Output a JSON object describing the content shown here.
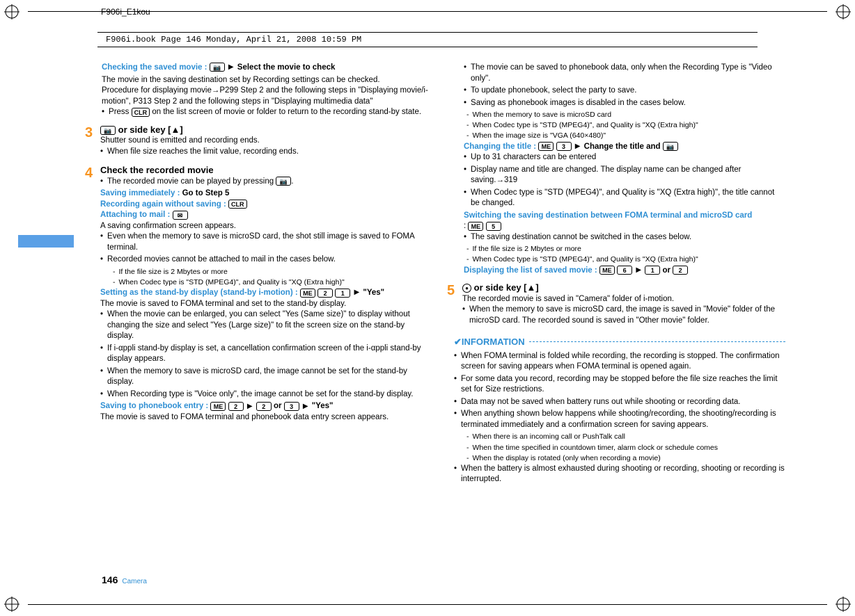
{
  "doc_header": "F906i_E1kou",
  "book_meta": "F906i.book  Page 146  Monday, April 21, 2008  10:59 PM",
  "page_number": "146",
  "page_category": "Camera",
  "left": {
    "check_saved": {
      "label": "Checking the saved movie : ",
      "after": "Select the movie to check",
      "desc1": "The movie in the saving destination set by Recording settings can be checked.",
      "desc2": "Procedure for displaying movie→P299 Step 2 and the following steps in \"Displaying movie/i-motion\", P313 Step 2 and the following steps in \"Displaying multimedia data\"",
      "bullet1_a": "Press ",
      "bullet1_b": " on the list screen of movie or folder to return to the recording stand-by state."
    },
    "step3": {
      "num": "3",
      "head_a": " or side key [",
      "head_b": "]",
      "l1": "Shutter sound is emitted and recording ends.",
      "b1": "When file size reaches the limit value, recording ends."
    },
    "step4": {
      "num": "4",
      "head": "Check the recorded movie",
      "b1_a": "The recorded movie can be played by pressing ",
      "b1_b": ".",
      "save_imm_lbl": "Saving immediately : ",
      "save_imm_val": "Go to Step 5",
      "rec_again_lbl": "Recording again without saving : ",
      "attach_lbl": "Attaching to mail : ",
      "attach_l1": "A saving confirmation screen appears.",
      "attach_b1": "Even when the memory to save is microSD card, the shot still image is saved to FOMA terminal.",
      "attach_b2": "Recorded movies cannot be attached to mail in the cases below.",
      "attach_d1": "If the file size is 2 Mbytes or more",
      "attach_d2": "When Codec type is \"STD (MPEG4)\", and Quality is \"XQ (Extra high)\"",
      "standby_lbl": "Setting as the stand-by display (stand-by i-motion) : ",
      "standby_after": "\"Yes\"",
      "standby_l1": "The movie is saved to FOMA terminal and set to the stand-by display.",
      "standby_b1": "When the movie can be enlarged, you can select \"Yes (Same size)\" to display without changing the size and select \"Yes (Large size)\" to fit the screen size on the stand-by display.",
      "standby_b2": "If i-αppli stand-by display is set, a cancellation confirmation screen of the i-αppli stand-by display appears.",
      "standby_b3": "When the memory to save is microSD card, the image cannot be set for the stand-by display.",
      "standby_b4": "When Recording type is \"Voice only\", the image cannot be set for the stand-by display.",
      "pb_lbl": "Saving to phonebook entry : ",
      "pb_mid": " or ",
      "pb_after": "\"Yes\"",
      "pb_l1": "The movie is saved to FOMA terminal and phonebook data entry screen appears."
    }
  },
  "right": {
    "pb_b1": "The movie can be saved to phonebook data, only when the Recording Type is \"Video only\".",
    "pb_b2": "To update phonebook, select the party to save.",
    "pb_b3": "Saving as phonebook images is disabled in the cases below.",
    "pb_d1": "When the memory to save is microSD card",
    "pb_d2": "When Codec type is \"STD (MPEG4)\", and Quality is \"XQ (Extra high)\"",
    "pb_d3": "When the image size is \"VGA (640×480)\"",
    "title_lbl": "Changing the title : ",
    "title_after": "Change the title and ",
    "title_b1": "Up to 31 characters can be entered",
    "title_b2": "Display name and title are changed. The display name can be changed after saving.→319",
    "title_b3": "When Codec type is \"STD (MPEG4)\", and Quality is \"XQ (Extra high)\", the title cannot be changed.",
    "switch_lbl": "Switching the saving destination between FOMA terminal and microSD card",
    "switch_pre": " : ",
    "switch_b1": "The saving destination cannot be switched in the cases below.",
    "switch_d1": "If the file size is 2 Mbytes or more",
    "switch_d2": "When Codec type is \"STD (MPEG4)\", and Quality is \"XQ (Extra high)\"",
    "list_lbl": "Displaying the list of saved movie : ",
    "list_mid": " or ",
    "step5": {
      "num": "5",
      "head_a": " or side key [",
      "head_b": "]",
      "l1": "The recorded movie is saved in \"Camera\" folder of i-motion.",
      "b1": "When the memory to save is microSD card, the image is saved in \"Movie\" folder of the microSD card. The recorded sound is saved in \"Other movie\" folder."
    },
    "info_title": "✔INFORMATION",
    "info_b1": "When FOMA terminal is folded while recording, the recording is stopped. The confirmation screen for saving appears when FOMA terminal is opened again.",
    "info_b2": "For some data you record, recording may be stopped before the file size reaches the limit set for Size restrictions.",
    "info_b3": "Data may not be saved when battery runs out while shooting or recording data.",
    "info_b4": "When anything shown below happens while shooting/recording, the shooting/recording is terminated immediately and a confirmation screen for saving appears.",
    "info_d1": "When there is an incoming call or PushTalk call",
    "info_d2": "When the time specified in countdown timer, alarm clock or schedule comes",
    "info_d3": "When the display is rotated (only when recording a movie)",
    "info_b5": "When the battery is almost exhausted during shooting or recording, shooting or recording is interrupted."
  },
  "keys": {
    "camera": "📷",
    "clr": "CLR",
    "mail": "✉",
    "me": "ME",
    "k1": "1",
    "k2": "2",
    "k3": "3",
    "k5": "5",
    "k6": "6",
    "tri_up": "▲",
    "dot": "●"
  }
}
